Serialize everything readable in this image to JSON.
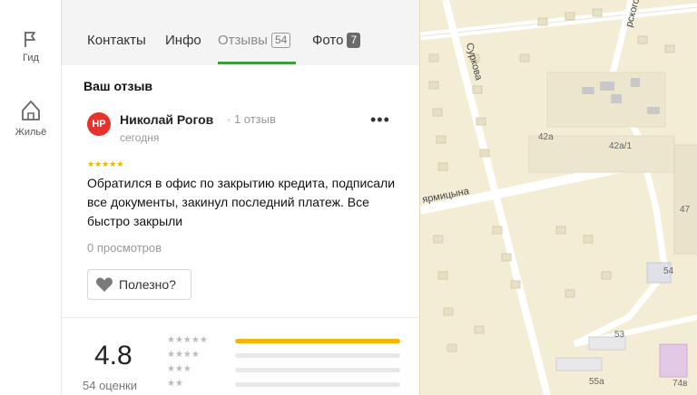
{
  "rail": {
    "guide_label": "Гид",
    "housing_label": "Жильё"
  },
  "tabs": {
    "contacts": "Контакты",
    "info": "Инфо",
    "reviews": "Отзывы",
    "reviews_count": "54",
    "photos": "Фото",
    "photos_count": "7"
  },
  "review": {
    "section_title": "Ваш отзыв",
    "avatar_initials": "НР",
    "author": "Николай Рогов",
    "author_meta": "· 1 отзыв",
    "date": "сегодня",
    "stars": 5,
    "text": "Обратился в офис по закрытию кредита, подписали все документы, закинул последний платеж. Все быстро закрыли",
    "views": "0 просмотров",
    "useful_label": "Полезно?"
  },
  "rating": {
    "value": "4.8",
    "count_label": "54 оценки",
    "distribution": [
      {
        "stars": 5,
        "fraction": 1.0
      },
      {
        "stars": 4,
        "fraction": 0.0
      },
      {
        "stars": 3,
        "fraction": 0.0
      },
      {
        "stars": 2,
        "fraction": 0.0
      }
    ]
  },
  "map": {
    "streets": [
      "Суркова",
      "ярмицына",
      "рского"
    ],
    "building_numbers": [
      "42а",
      "42а/1",
      "47",
      "54",
      "53",
      "55а",
      "74в"
    ]
  },
  "colors": {
    "accent_green": "#3ca03c",
    "star_yellow": "#f5b400",
    "avatar_red": "#e5322d"
  }
}
